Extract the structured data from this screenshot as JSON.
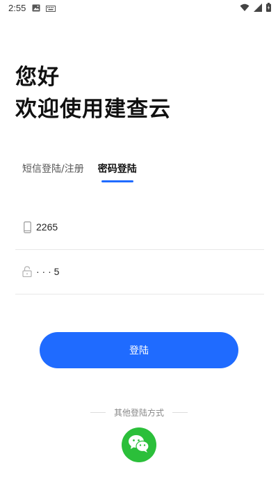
{
  "status_bar": {
    "time": "2:55"
  },
  "greeting": {
    "line1": "您好",
    "line2": "欢迎使用建查云"
  },
  "tabs": [
    {
      "label": "短信登陆/注册",
      "active": false
    },
    {
      "label": "密码登陆",
      "active": true
    }
  ],
  "phone_field": {
    "value": "2265",
    "icon": "phone-icon"
  },
  "password_field": {
    "value": "· · · 5",
    "icon": "lock-icon"
  },
  "login_button": {
    "label": "登陆"
  },
  "other_methods": {
    "label": "其他登陆方式",
    "icon": "wechat-icon"
  },
  "colors": {
    "accent": "#1f6bff",
    "wechat": "#2bbf3a"
  }
}
